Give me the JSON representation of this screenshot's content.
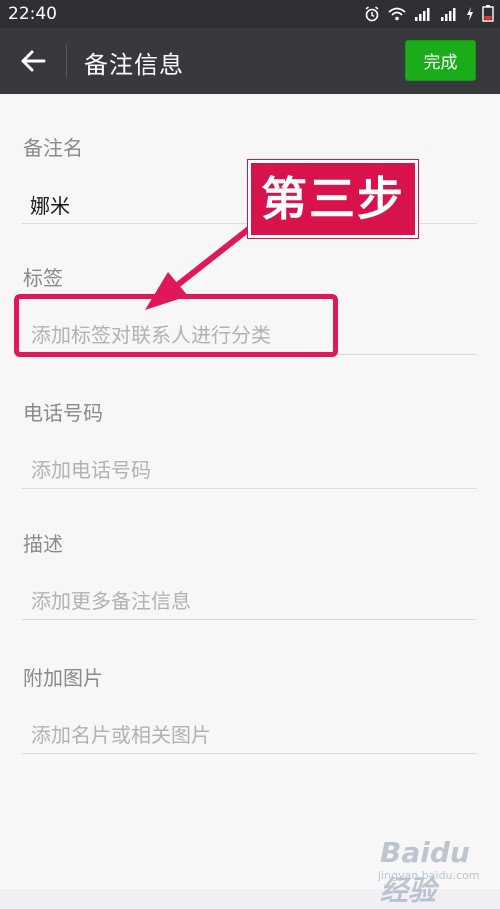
{
  "status_bar": {
    "time": "22:40"
  },
  "header": {
    "title": "备注信息",
    "done_label": "完成"
  },
  "fields": {
    "remark_name": {
      "label": "备注名",
      "value": "娜米"
    },
    "tags": {
      "label": "标签",
      "placeholder": "添加标签对联系人进行分类"
    },
    "phone": {
      "label": "电话号码",
      "placeholder": "添加电话号码"
    },
    "description": {
      "label": "描述",
      "placeholder": "添加更多备注信息"
    },
    "images": {
      "label": "附加图片",
      "placeholder": "添加名片或相关图片"
    }
  },
  "annotation": {
    "callout": "第三步",
    "color": "#d8124a"
  },
  "watermark": {
    "brand": "Baidu经验",
    "url": "jingyan.baidu.com"
  },
  "colors": {
    "accent": "#1aad19",
    "title_bar": "#38393d",
    "status_bar": "#2f3033"
  }
}
